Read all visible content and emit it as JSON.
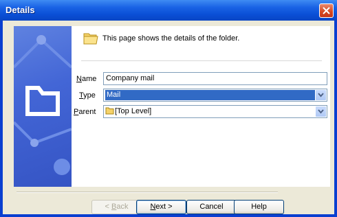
{
  "window": {
    "title": "Details"
  },
  "header": {
    "description": "This page shows the details of the folder."
  },
  "form": {
    "name": {
      "label_key": "N",
      "label_rest": "ame",
      "value": "Company mail"
    },
    "type": {
      "label_key": "T",
      "label_rest": "ype",
      "value": "Mail"
    },
    "parent": {
      "label_key": "P",
      "label_rest": "arent",
      "value": "[Top Level]"
    }
  },
  "buttons": {
    "back": {
      "pre": "< ",
      "key": "B",
      "rest": "ack"
    },
    "next": {
      "key": "N",
      "rest": "ext >"
    },
    "cancel": "Cancel",
    "help": "Help"
  },
  "icons": {
    "close": "close-icon",
    "folder": "folder-icon",
    "side": "folder-outline-icon",
    "dropdown": "chevron-down-icon"
  },
  "colors": {
    "titlebar": "#0a4fd6",
    "selection": "#316ac5",
    "dialog_bg": "#ece9d8",
    "close": "#d4461f"
  }
}
